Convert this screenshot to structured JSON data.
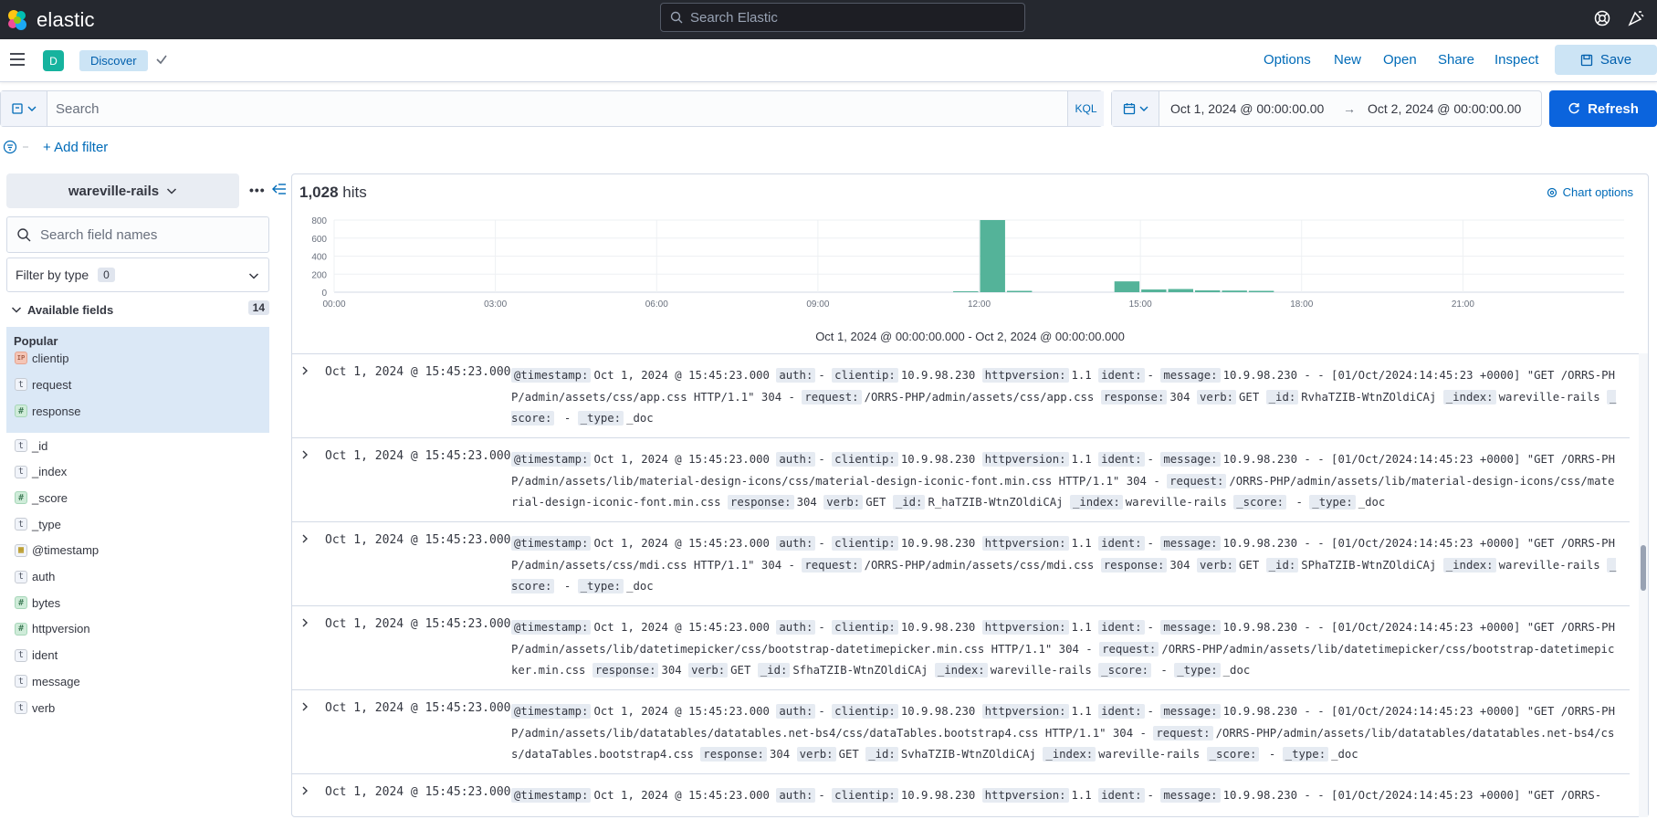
{
  "header": {
    "brand": "elastic",
    "global_search_placeholder": "Search Elastic"
  },
  "appbar": {
    "space_initial": "D",
    "breadcrumb": "Discover",
    "nav": {
      "options": "Options",
      "new": "New",
      "open": "Open",
      "share": "Share",
      "inspect": "Inspect",
      "save": "Save"
    }
  },
  "query": {
    "placeholder": "Search",
    "language": "KQL",
    "date_start": "Oct 1, 2024 @ 00:00:00.00",
    "date_arrow": "→",
    "date_end": "Oct 2, 2024 @ 00:00:00.00",
    "refresh": "Refresh",
    "add_filter": "+ Add filter"
  },
  "sidebar": {
    "index_pattern": "wareville-rails",
    "field_search_placeholder": "Search field names",
    "filter_by_type": "Filter by type",
    "filter_count": "0",
    "available_fields": "Available fields",
    "available_count": "14",
    "popular_title": "Popular",
    "popular": [
      {
        "type": "IP",
        "name": "clientip"
      },
      {
        "type": "t",
        "name": "request"
      },
      {
        "type": "#",
        "name": "response"
      }
    ],
    "fields": [
      {
        "type": "t",
        "name": "_id"
      },
      {
        "type": "t",
        "name": "_index"
      },
      {
        "type": "#",
        "name": "_score"
      },
      {
        "type": "t",
        "name": "_type"
      },
      {
        "type": "date",
        "name": "@timestamp"
      },
      {
        "type": "t",
        "name": "auth"
      },
      {
        "type": "#",
        "name": "bytes"
      },
      {
        "type": "#",
        "name": "httpversion"
      },
      {
        "type": "t",
        "name": "ident"
      },
      {
        "type": "t",
        "name": "message"
      },
      {
        "type": "t",
        "name": "verb"
      }
    ]
  },
  "main": {
    "hits_count": "1,028",
    "hits_label": "hits",
    "chart_options": "Chart options",
    "chart_range": "Oct 1, 2024 @ 00:00:00.000 - Oct 2, 2024 @ 00:00:00.000"
  },
  "chart_data": {
    "type": "bar",
    "title": "",
    "xlabel": "",
    "ylabel": "",
    "x_ticks": [
      "00:00",
      "03:00",
      "06:00",
      "09:00",
      "12:00",
      "15:00",
      "18:00",
      "21:00"
    ],
    "y_ticks": [
      0,
      200,
      400,
      600,
      800
    ],
    "ylim": [
      0,
      800
    ],
    "bucket_minutes": 30,
    "x_minutes": [
      690,
      720,
      750,
      870,
      900,
      930,
      960,
      990,
      1020
    ],
    "values": [
      10,
      800,
      15,
      120,
      30,
      35,
      20,
      18,
      15
    ],
    "color": "#54b399",
    "grid": true
  },
  "documents": [
    {
      "timestamp": "Oct 1, 2024 @ 15:45:23.000",
      "fields": [
        {
          "k": "@timestamp:",
          "v": "Oct 1, 2024 @ 15:45:23.000"
        },
        {
          "k": "auth:",
          "v": "-"
        },
        {
          "k": "clientip:",
          "v": "10.9.98.230"
        },
        {
          "k": "httpversion:",
          "v": "1.1"
        },
        {
          "k": "ident:",
          "v": "-"
        },
        {
          "k": "message:",
          "v": "10.9.98.230 - - [01/Oct/2024:14:45:23 +0000] \"GET /ORRS-PHP/admin/assets/css/app.css HTTP/1.1\" 304 -"
        },
        {
          "k": "request:",
          "v": "/ORRS-PHP/admin/assets/css/app.css"
        },
        {
          "k": "response:",
          "v": "304"
        },
        {
          "k": "verb:",
          "v": "GET"
        },
        {
          "k": "_id:",
          "v": "RvhaTZIB-WtnZOldiCAj"
        },
        {
          "k": "_index:",
          "v": "wareville-rails"
        },
        {
          "k": "_score:",
          "v": " -"
        },
        {
          "k": "_type:",
          "v": "_doc"
        }
      ]
    },
    {
      "timestamp": "Oct 1, 2024 @ 15:45:23.000",
      "fields": [
        {
          "k": "@timestamp:",
          "v": "Oct 1, 2024 @ 15:45:23.000"
        },
        {
          "k": "auth:",
          "v": "-"
        },
        {
          "k": "clientip:",
          "v": "10.9.98.230"
        },
        {
          "k": "httpversion:",
          "v": "1.1"
        },
        {
          "k": "ident:",
          "v": "-"
        },
        {
          "k": "message:",
          "v": "10.9.98.230 - - [01/Oct/2024:14:45:23 +0000] \"GET /ORRS-PHP/admin/assets/lib/material-design-icons/css/material-design-iconic-font.min.css HTTP/1.1\" 304 -"
        },
        {
          "k": "request:",
          "v": "/ORRS-PHP/admin/assets/lib/material-design-icons/css/material-design-iconic-font.min.css"
        },
        {
          "k": "response:",
          "v": "304"
        },
        {
          "k": "verb:",
          "v": "GET"
        },
        {
          "k": "_id:",
          "v": "R_haTZIB-WtnZOldiCAj"
        },
        {
          "k": "_index:",
          "v": "wareville-rails"
        },
        {
          "k": "_score:",
          "v": " -"
        },
        {
          "k": "_type:",
          "v": "_doc"
        }
      ]
    },
    {
      "timestamp": "Oct 1, 2024 @ 15:45:23.000",
      "fields": [
        {
          "k": "@timestamp:",
          "v": "Oct 1, 2024 @ 15:45:23.000"
        },
        {
          "k": "auth:",
          "v": "-"
        },
        {
          "k": "clientip:",
          "v": "10.9.98.230"
        },
        {
          "k": "httpversion:",
          "v": "1.1"
        },
        {
          "k": "ident:",
          "v": "-"
        },
        {
          "k": "message:",
          "v": "10.9.98.230 - - [01/Oct/2024:14:45:23 +0000] \"GET /ORRS-PHP/admin/assets/css/mdi.css HTTP/1.1\" 304 -"
        },
        {
          "k": "request:",
          "v": "/ORRS-PHP/admin/assets/css/mdi.css"
        },
        {
          "k": "response:",
          "v": "304"
        },
        {
          "k": "verb:",
          "v": "GET"
        },
        {
          "k": "_id:",
          "v": "SPhaTZIB-WtnZOldiCAj"
        },
        {
          "k": "_index:",
          "v": "wareville-rails"
        },
        {
          "k": "_score:",
          "v": " -"
        },
        {
          "k": "_type:",
          "v": "_doc"
        }
      ]
    },
    {
      "timestamp": "Oct 1, 2024 @ 15:45:23.000",
      "fields": [
        {
          "k": "@timestamp:",
          "v": "Oct 1, 2024 @ 15:45:23.000"
        },
        {
          "k": "auth:",
          "v": "-"
        },
        {
          "k": "clientip:",
          "v": "10.9.98.230"
        },
        {
          "k": "httpversion:",
          "v": "1.1"
        },
        {
          "k": "ident:",
          "v": "-"
        },
        {
          "k": "message:",
          "v": "10.9.98.230 - - [01/Oct/2024:14:45:23 +0000] \"GET /ORRS-PHP/admin/assets/lib/datetimepicker/css/bootstrap-datetimepicker.min.css HTTP/1.1\" 304 -"
        },
        {
          "k": "request:",
          "v": "/ORRS-PHP/admin/assets/lib/datetimepicker/css/bootstrap-datetimepicker.min.css"
        },
        {
          "k": "response:",
          "v": "304"
        },
        {
          "k": "verb:",
          "v": "GET"
        },
        {
          "k": "_id:",
          "v": "SfhaTZIB-WtnZOldiCAj"
        },
        {
          "k": "_index:",
          "v": "wareville-rails"
        },
        {
          "k": "_score:",
          "v": " -"
        },
        {
          "k": "_type:",
          "v": "_doc"
        }
      ]
    },
    {
      "timestamp": "Oct 1, 2024 @ 15:45:23.000",
      "fields": [
        {
          "k": "@timestamp:",
          "v": "Oct 1, 2024 @ 15:45:23.000"
        },
        {
          "k": "auth:",
          "v": "-"
        },
        {
          "k": "clientip:",
          "v": "10.9.98.230"
        },
        {
          "k": "httpversion:",
          "v": "1.1"
        },
        {
          "k": "ident:",
          "v": "-"
        },
        {
          "k": "message:",
          "v": "10.9.98.230 - - [01/Oct/2024:14:45:23 +0000] \"GET /ORRS-PHP/admin/assets/lib/datatables/datatables.net-bs4/css/dataTables.bootstrap4.css HTTP/1.1\" 304 -"
        },
        {
          "k": "request:",
          "v": "/ORRS-PHP/admin/assets/lib/datatables/datatables.net-bs4/css/dataTables.bootstrap4.css"
        },
        {
          "k": "response:",
          "v": "304"
        },
        {
          "k": "verb:",
          "v": "GET"
        },
        {
          "k": "_id:",
          "v": "SvhaTZIB-WtnZOldiCAj"
        },
        {
          "k": "_index:",
          "v": "wareville-rails"
        },
        {
          "k": "_score:",
          "v": " -"
        },
        {
          "k": "_type:",
          "v": "_doc"
        }
      ]
    },
    {
      "timestamp": "Oct 1, 2024 @ 15:45:23.000",
      "fields": [
        {
          "k": "@timestamp:",
          "v": "Oct 1, 2024 @ 15:45:23.000"
        },
        {
          "k": "auth:",
          "v": "-"
        },
        {
          "k": "clientip:",
          "v": "10.9.98.230"
        },
        {
          "k": "httpversion:",
          "v": "1.1"
        },
        {
          "k": "ident:",
          "v": "-"
        },
        {
          "k": "message:",
          "v": "10.9.98.230 - - [01/Oct/2024:14:45:23 +0000] \"GET /ORRS-"
        }
      ]
    }
  ]
}
